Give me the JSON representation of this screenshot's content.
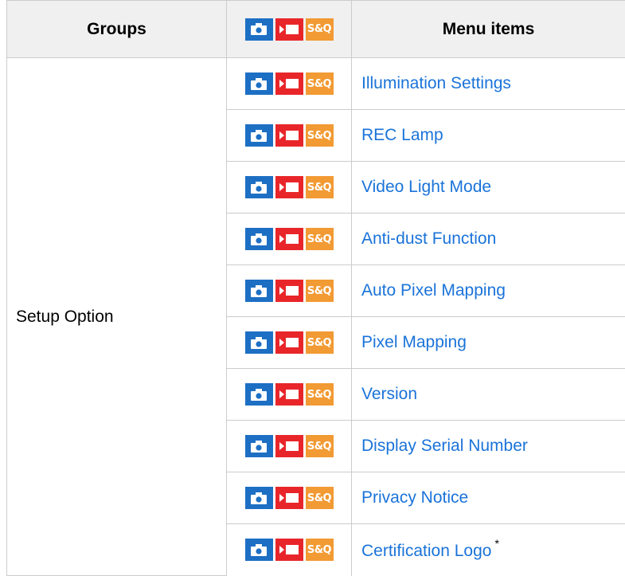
{
  "header": {
    "groups_label": "Groups",
    "menu_items_label": "Menu items",
    "sq_label": "S&Q"
  },
  "colors": {
    "photo_badge": "#1d6fc4",
    "movie_badge": "#e8262a",
    "sq_badge": "#f29a33",
    "link": "#1a73d9"
  },
  "group": {
    "label": "Setup Option"
  },
  "rows": [
    {
      "label": "Illumination Settings",
      "sq": "S&Q"
    },
    {
      "label": "REC Lamp",
      "sq": "S&Q"
    },
    {
      "label": "Video Light Mode",
      "sq": "S&Q"
    },
    {
      "label": "Anti-dust Function",
      "sq": "S&Q"
    },
    {
      "label": "Auto Pixel Mapping",
      "sq": "S&Q"
    },
    {
      "label": "Pixel Mapping",
      "sq": "S&Q"
    },
    {
      "label": "Version",
      "sq": "S&Q"
    },
    {
      "label": "Display Serial Number",
      "sq": "S&Q"
    },
    {
      "label": "Privacy Notice",
      "sq": "S&Q"
    },
    {
      "label": "Certification Logo",
      "sq": "S&Q",
      "footnote": "*"
    }
  ]
}
